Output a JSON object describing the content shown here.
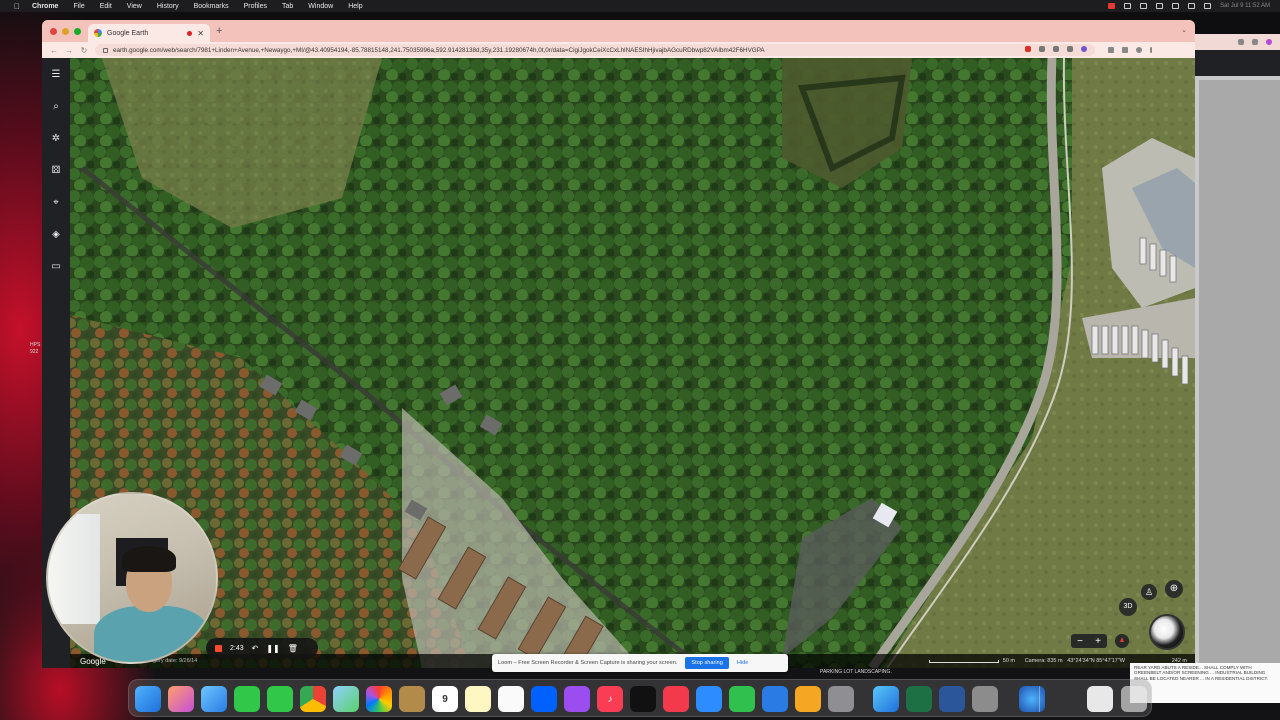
{
  "menubar": {
    "app_name": "Chrome",
    "items": [
      "File",
      "Edit",
      "View",
      "History",
      "Bookmarks",
      "Profiles",
      "Tab",
      "Window",
      "Help"
    ],
    "clock": "Sat Jul 9 11:52 AM"
  },
  "browser": {
    "tab_title": "Google Earth",
    "url": "earth.google.com/web/search/7981+Linden+Avenue,+Newaygo,+MI/@43.40954194,-85.78815148,241.75035996a,592.91428138d,35y,231.19280674h,0t,0r/data=CigiJgokCeiXcCxLhlNAESIhHjivajbAGcuRDbwp82VAIbm42F6HVGPA"
  },
  "earth": {
    "google_label": "Google",
    "imagery_date": "Imagery date: 9/26/14",
    "scale_label": "50 m",
    "camera": "Camera: 835 m",
    "coordinates": "43°24'34\"N 85°47'17\"W",
    "altitude": "242 m",
    "btn_3d": "3D",
    "zoom_out": "−",
    "zoom_in": "+"
  },
  "loom": {
    "timer": "2:43",
    "share_message": "Loom – Free Screen Recorder & Screen Capture is sharing your screen.",
    "stop_sharing": "Stop sharing",
    "hide": "Hide"
  },
  "background": {
    "parking_note": "PARKING LOT LANDSCAPING.",
    "doc_note": "REAR YARD ABUTS A RESIDE... SHALL COMPLY WITH GREENBELT AND/OR SCREENING ... INDUSTRIAL BUILDING SHALL BE LOCATED NEARER ... IN A RESIDENTIAL DISTRICT.",
    "desktop_note": "HPS 922"
  },
  "dock": {
    "calendar_day": "9"
  },
  "colors": {
    "accent": "#1a73e8",
    "tabstrip": "#f2c2bb",
    "record": "#ff4a2e"
  }
}
